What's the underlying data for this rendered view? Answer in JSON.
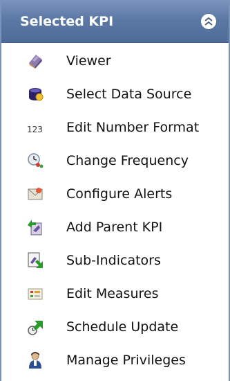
{
  "panel": {
    "title": "Selected KPI"
  },
  "items": [
    {
      "label": "Viewer",
      "icon": "viewer-icon"
    },
    {
      "label": "Select Data Source",
      "icon": "data-source-icon"
    },
    {
      "label": "Edit Number Format",
      "icon": "number-format-icon",
      "icon_text": "123"
    },
    {
      "label": "Change Frequency",
      "icon": "frequency-icon"
    },
    {
      "label": "Configure Alerts",
      "icon": "alerts-icon"
    },
    {
      "label": "Add Parent KPI",
      "icon": "add-parent-icon"
    },
    {
      "label": "Sub-Indicators",
      "icon": "sub-indicators-icon"
    },
    {
      "label": "Edit Measures",
      "icon": "measures-icon"
    },
    {
      "label": "Schedule Update",
      "icon": "schedule-icon"
    },
    {
      "label": "Manage Privileges",
      "icon": "privileges-icon"
    }
  ],
  "colors": {
    "header": "#5c79a6",
    "border": "#7a93b8"
  }
}
